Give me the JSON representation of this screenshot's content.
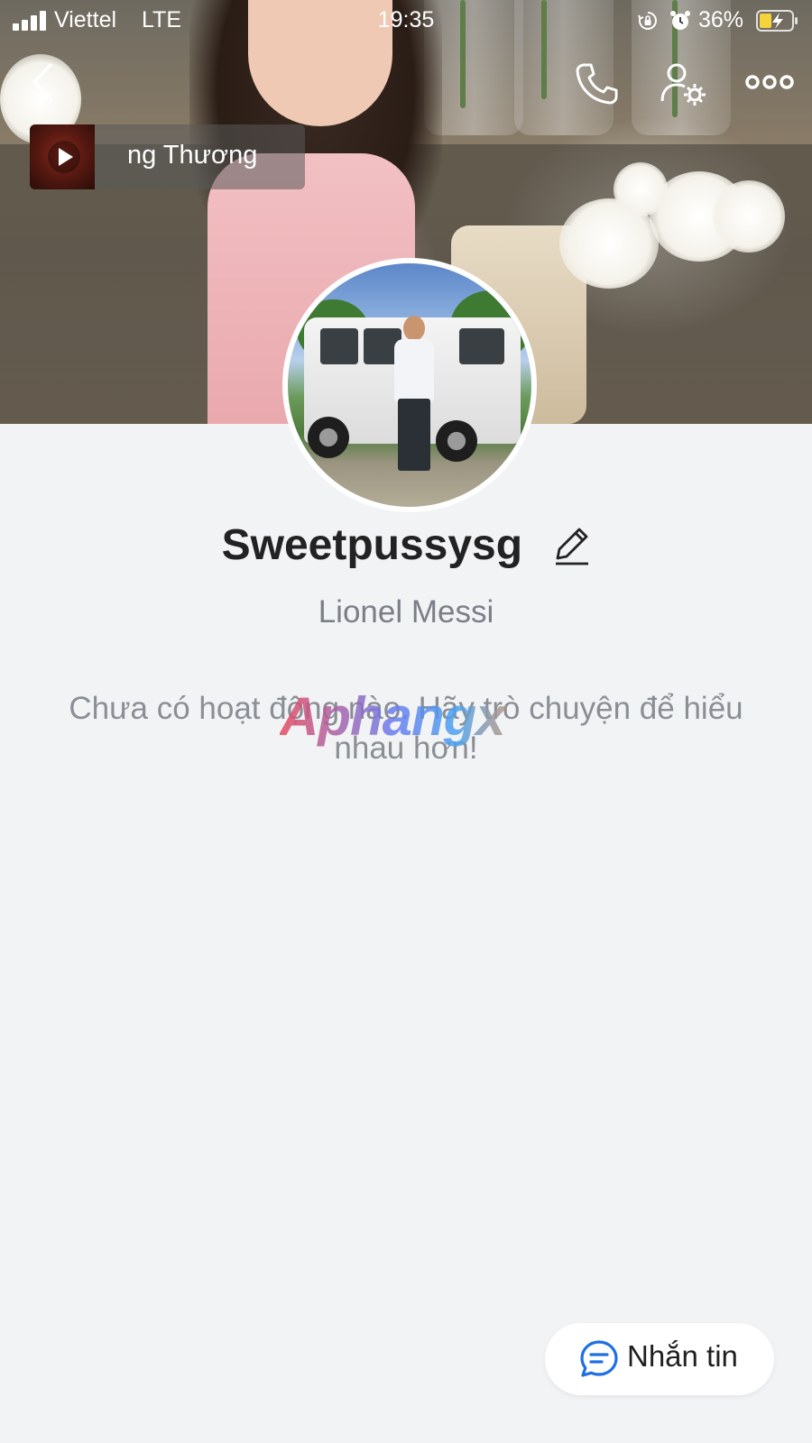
{
  "status_bar": {
    "carrier": "Viettel",
    "network": "LTE",
    "time": "19:35",
    "battery_percent": "36%",
    "icons": [
      "signal-icon",
      "rotation-lock-icon",
      "alarm-icon",
      "battery-charging-icon"
    ]
  },
  "header": {
    "back_icon": "chevron-left-icon",
    "call_icon": "phone-icon",
    "settings_icon": "user-settings-icon",
    "more_icon": "more-horizontal-icon"
  },
  "music": {
    "song_title": "ng Thương",
    "play_icon": "play-icon"
  },
  "profile": {
    "display_name": "Sweetpussysg",
    "alias": "Lionel Messi",
    "edit_icon": "pencil-icon"
  },
  "feed": {
    "empty_message": "Chưa có hoạt động nào. Hãy trò chuyện để hiểu nhau hơn!"
  },
  "watermark": {
    "text": "Aphangx"
  },
  "actions": {
    "message_label": "Nhắn tin",
    "message_icon": "chat-bubble-icon"
  },
  "colors": {
    "page_background": "#f2f3f5",
    "accent_blue": "#1e6fe3",
    "secondary_text": "#7a7f87"
  }
}
